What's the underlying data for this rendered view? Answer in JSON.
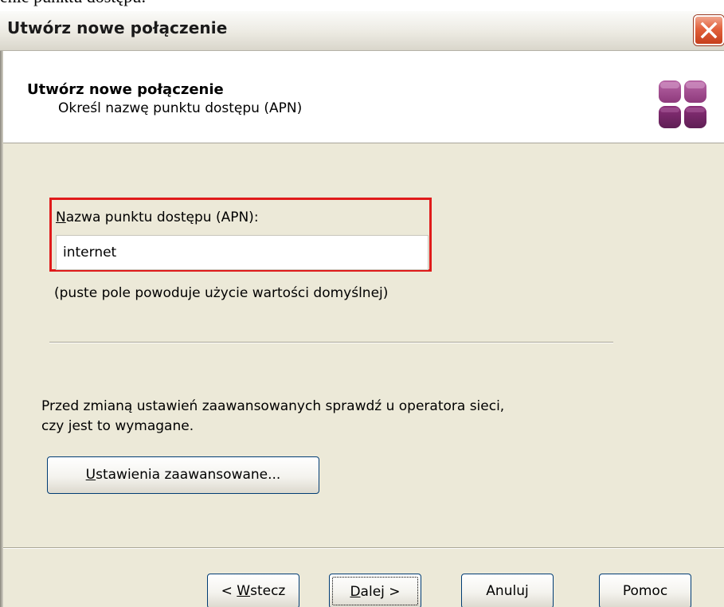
{
  "page_fragment": "enie punktu dostępu:",
  "window": {
    "title": "Utwórz nowe połączenie",
    "close_icon": "close-icon"
  },
  "header": {
    "title": "Utwórz nowe połączenie",
    "subtitle": "Określ nazwę punktu dostępu (APN)",
    "logo_icon": "wizard-tiles-icon",
    "logo_color": "#7b2a68"
  },
  "apn": {
    "label_mnemonic": "N",
    "label_rest": "azwa punktu dostępu (APN):",
    "value": "internet",
    "hint": "(puste pole powoduje użycie wartości domyślnej)",
    "highlight_color": "#e01b1b"
  },
  "advanced": {
    "note_line1": "Przed zmianą ustawień zaawansowanych sprawdź u operatora sieci,",
    "note_line2": "czy jest to wymagane.",
    "button_mnemonic": "U",
    "button_rest": "stawienia zaawansowane..."
  },
  "nav": {
    "back_prefix": "< ",
    "back_mnemonic": "W",
    "back_rest": "stecz",
    "next_mnemonic": "D",
    "next_rest": "alej >",
    "cancel_label": "Anuluj",
    "help_label": "Pomoc"
  }
}
